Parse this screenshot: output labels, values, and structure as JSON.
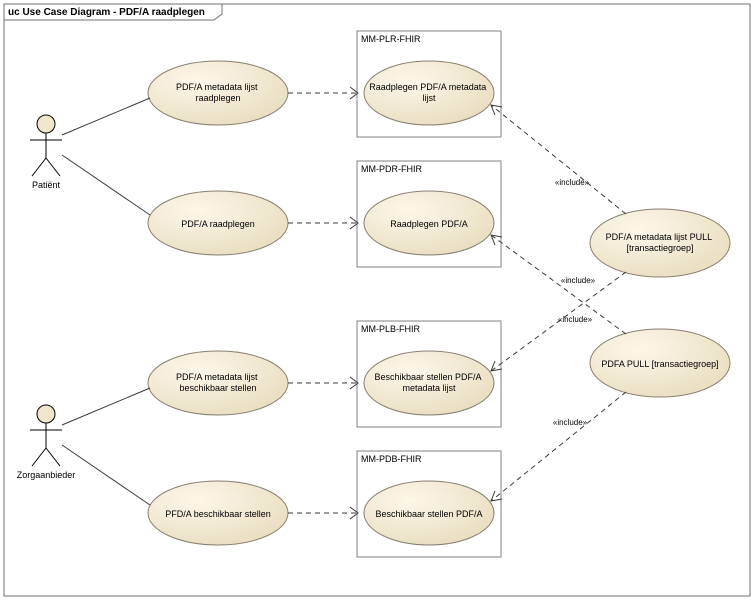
{
  "panel": {
    "prefix": "uc ",
    "title": "Use Case Diagram - PDF/A raadplegen"
  },
  "actors": {
    "patient": "Patiënt",
    "zorgaanbieder": "Zorgaanbieder"
  },
  "usecases": {
    "uc1": "PDF/A metadata lijst raadplegen",
    "uc2": "PDF/A raadplegen",
    "uc3": "PDF/A metadata lijst beschikbaar stellen",
    "uc4": "PFD/A beschikbaar stellen"
  },
  "subsystems": {
    "s1": {
      "title": "MM-PLR-FHIR",
      "uc": "Raadplegen PDF/A metadata lijst"
    },
    "s2": {
      "title": "MM-PDR-FHIR",
      "uc": "Raadplegen PDF/A"
    },
    "s3": {
      "title": "MM-PLB-FHIR",
      "uc": "Beschikbaar stellen PDF/A metadata lijst"
    },
    "s4": {
      "title": "MM-PDB-FHIR",
      "uc": "Beschikbaar stellen PDF/A"
    }
  },
  "groups": {
    "g1": "PDF/A metadata lijst PULL [transactiegroep]",
    "g2": "PDFA PULL [transactiegroep]"
  },
  "labels": {
    "include": "«include»"
  }
}
